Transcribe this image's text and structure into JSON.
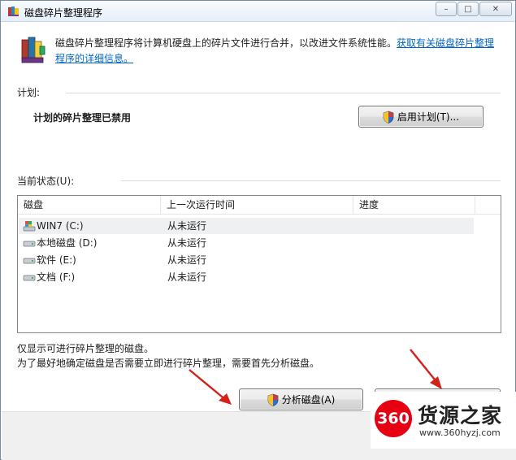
{
  "window": {
    "title": "磁盘碎片整理程序",
    "minimize_glyph": "–",
    "maximize_glyph": "□",
    "close_glyph": "✕"
  },
  "intro": {
    "text": "磁盘碎片整理程序将计算机硬盘上的碎片文件进行合并，以改进文件系统性能。",
    "link": "获取有关磁盘碎片整理程序的详细信息。"
  },
  "schedule": {
    "section_label": "计划:",
    "status": "计划的碎片整理已禁用",
    "button_label": "启用计划(T)..."
  },
  "current_status": {
    "section_label": "当前状态(U):",
    "columns": [
      "磁盘",
      "上一次运行时间",
      "进度"
    ],
    "rows": [
      {
        "disk": "WIN7 (C:)",
        "last_run": "从未运行",
        "progress": "",
        "icon": "system-drive-icon"
      },
      {
        "disk": "本地磁盘 (D:)",
        "last_run": "从未运行",
        "progress": "",
        "icon": "hard-drive-icon"
      },
      {
        "disk": "软件 (E:)",
        "last_run": "从未运行",
        "progress": "",
        "icon": "hard-drive-icon"
      },
      {
        "disk": "文档 (F:)",
        "last_run": "从未运行",
        "progress": "",
        "icon": "hard-drive-icon"
      }
    ]
  },
  "notes": {
    "line1": "仅显示可进行碎片整理的磁盘。",
    "line2": "为了最好地确定磁盘是否需要立即进行碎片整理，需要首先分析磁盘。"
  },
  "actions": {
    "analyze_label": "分析磁盘(A)"
  },
  "watermark": {
    "badge": "360",
    "title": "货源之家",
    "url": "www.360hyzj.com"
  },
  "colors": {
    "link": "#0066cc",
    "arrow": "#d2221b",
    "watermark_red": "#e60012"
  }
}
